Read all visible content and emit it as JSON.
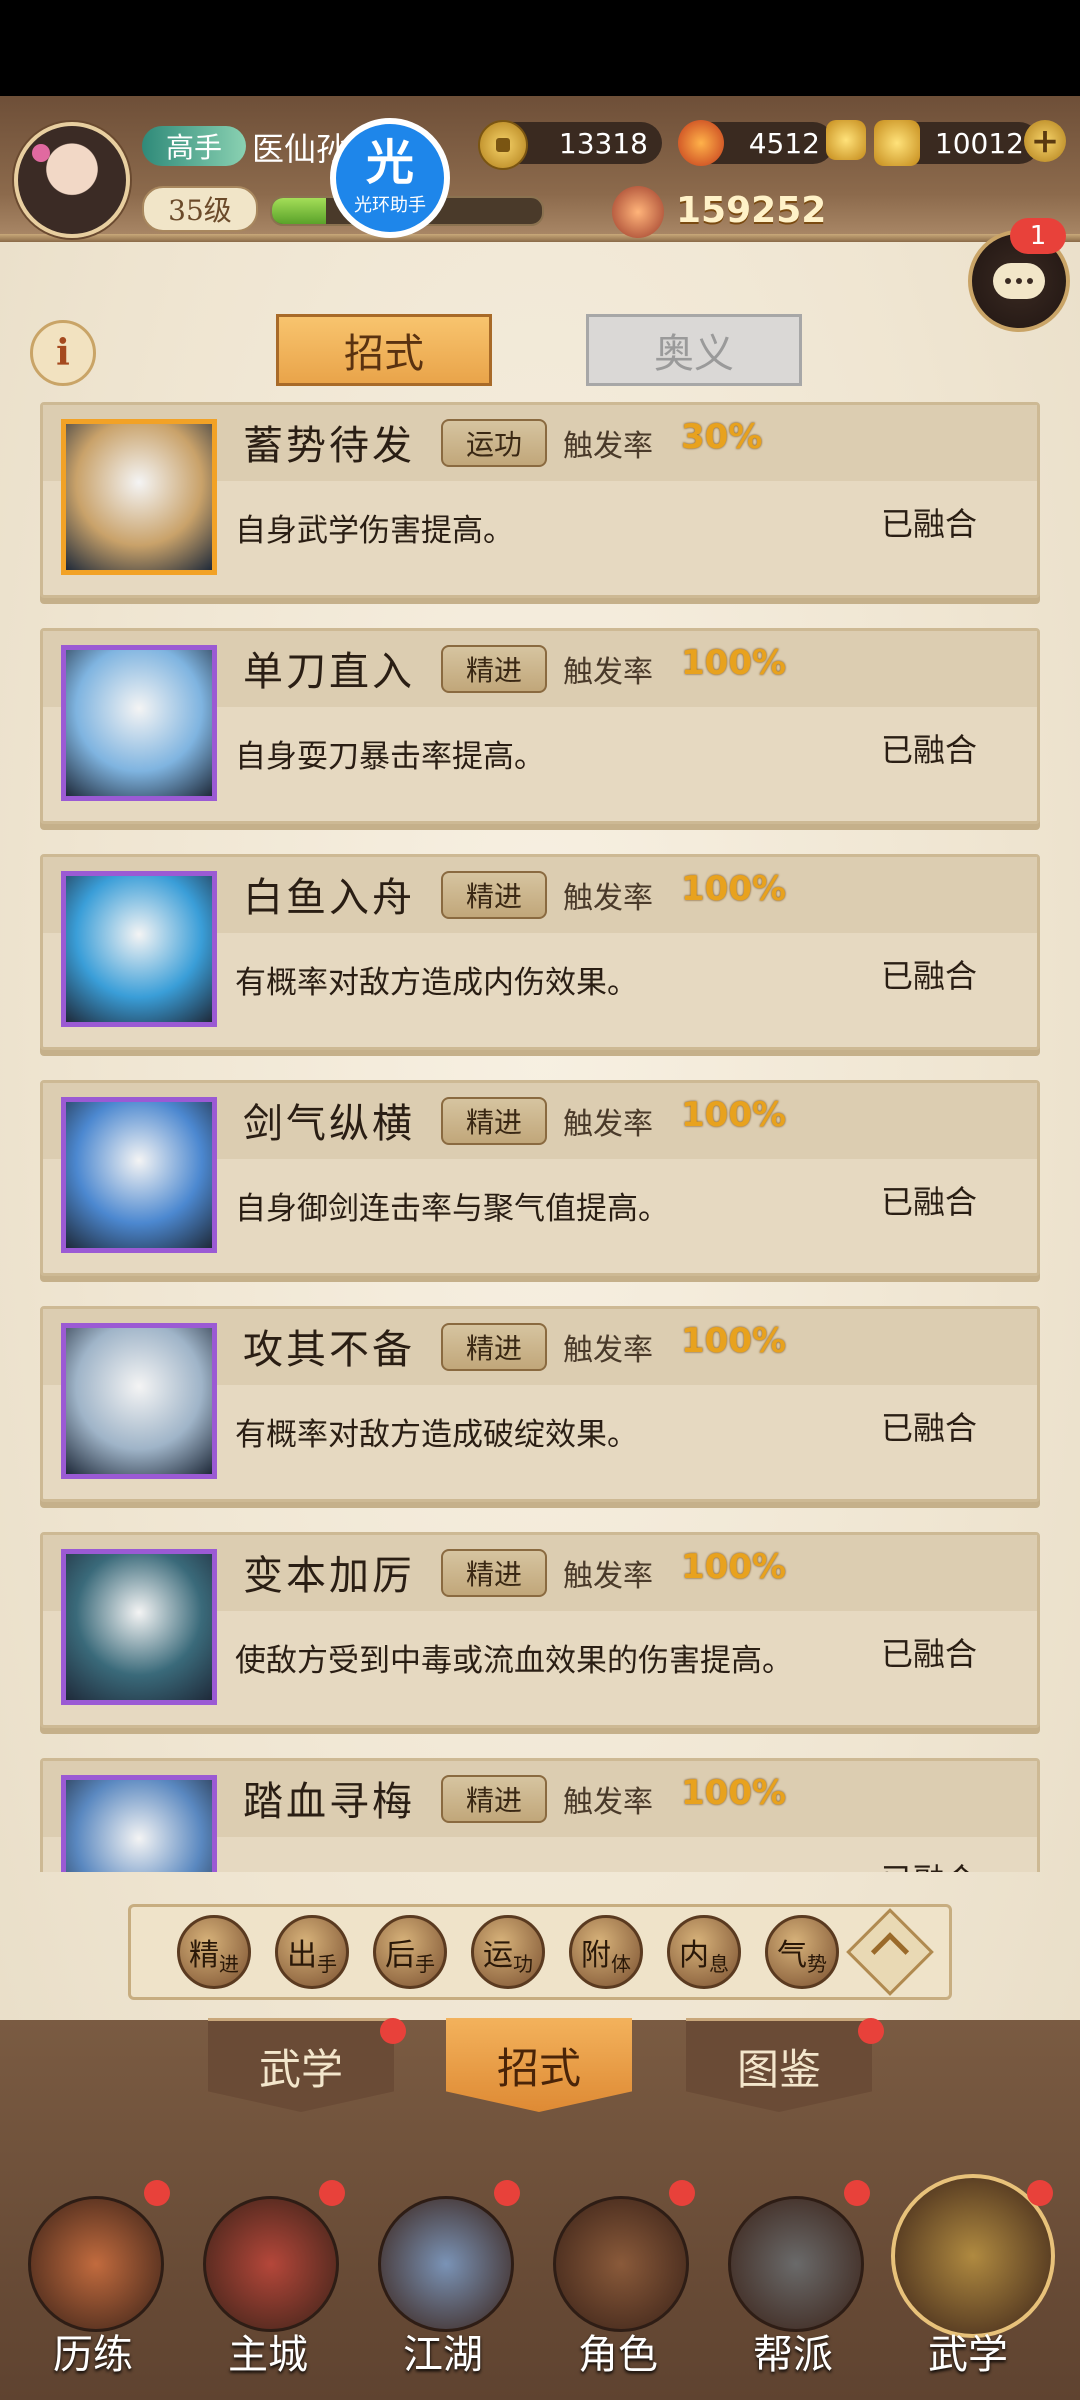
{
  "header": {
    "rank_badge": "高手",
    "player_name": "医仙孙",
    "level": "35级",
    "exp_fraction": 0.2,
    "helper_badge": {
      "char": "光",
      "label": "光环助手"
    },
    "copper": "13318",
    "jade": "4512",
    "gold": "10012",
    "power": "159252",
    "chat_notifications": "1"
  },
  "tabs": {
    "active": "招式",
    "inactive": "奥义"
  },
  "skill_labels": {
    "trigger": "触发率",
    "fused": "已融合"
  },
  "skills": [
    {
      "name": "蓄势待发",
      "tag": "运功",
      "rate": "30%",
      "desc": "自身武学伤害提高。",
      "icon_color": "#c9a26a",
      "frame": "gold"
    },
    {
      "name": "单刀直入",
      "tag": "精进",
      "rate": "100%",
      "desc": "自身耍刀暴击率提高。",
      "icon_color": "#7fb4e0",
      "frame": "purple"
    },
    {
      "name": "白鱼入舟",
      "tag": "精进",
      "rate": "100%",
      "desc": "有概率对敌方造成内伤效果。",
      "icon_color": "#3a9ed8",
      "frame": "purple"
    },
    {
      "name": "剑气纵横",
      "tag": "精进",
      "rate": "100%",
      "desc": "自身御剑连击率与聚气值提高。",
      "icon_color": "#4c88d0",
      "frame": "purple"
    },
    {
      "name": "攻其不备",
      "tag": "精进",
      "rate": "100%",
      "desc": "有概率对敌方造成破绽效果。",
      "icon_color": "#9fb4c8",
      "frame": "purple"
    },
    {
      "name": "变本加厉",
      "tag": "精进",
      "rate": "100%",
      "desc": "使敌方受到中毒或流血效果的伤害提高。",
      "icon_color": "#3a6a7a",
      "frame": "purple"
    },
    {
      "name": "踏血寻梅",
      "tag": "精进",
      "rate": "100%",
      "desc": "",
      "icon_color": "#5a88c0",
      "frame": "purple"
    }
  ],
  "filters": [
    {
      "top": "精",
      "sub": "进"
    },
    {
      "top": "出",
      "sub": "手"
    },
    {
      "top": "后",
      "sub": "手"
    },
    {
      "top": "运",
      "sub": "功"
    },
    {
      "top": "附",
      "sub": "体"
    },
    {
      "top": "内",
      "sub": "息"
    },
    {
      "top": "气",
      "sub": "势"
    }
  ],
  "section_tabs": [
    "武学",
    "招式",
    "图鉴"
  ],
  "section_active_index": 1,
  "bottom_nav": [
    "历练",
    "主城",
    "江湖",
    "角色",
    "帮派",
    "武学"
  ],
  "colors": {
    "accent": "#e8a21e",
    "notification": "#e8413a"
  }
}
